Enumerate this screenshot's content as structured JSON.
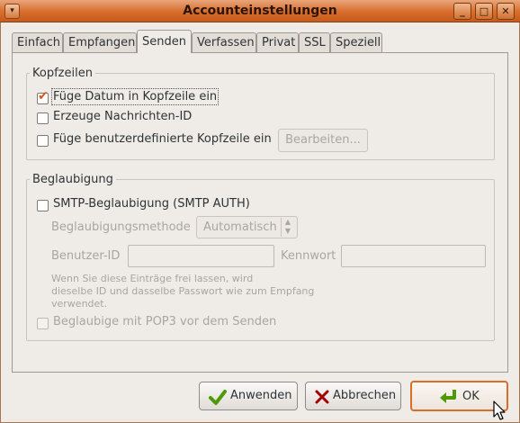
{
  "window": {
    "title": "Accounteinstellungen",
    "left_icon": "▾",
    "minimize_glyph": "_",
    "maximize_glyph": "□",
    "close_glyph": "✕"
  },
  "tabs": [
    {
      "label": "Einfach"
    },
    {
      "label": "Empfangen"
    },
    {
      "label": "Senden"
    },
    {
      "label": "Verfassen"
    },
    {
      "label": "Privat"
    },
    {
      "label": "SSL"
    },
    {
      "label": "Speziell"
    }
  ],
  "kopfzeilen": {
    "legend": "Kopfzeilen",
    "datum_label": "Füge Datum in Kopfzeile ein",
    "datum_checked": true,
    "nachrichten_id_label": "Erzeuge Nachrichten-ID",
    "nachrichten_id_checked": false,
    "benutzerdefiniert_label": "Füge benutzerdefinierte Kopfzeile ein",
    "benutzerdefiniert_checked": false,
    "bearbeiten_label": "Bearbeiten..."
  },
  "beglaubigung": {
    "legend": "Beglaubigung",
    "smtp_auth_label": "SMTP-Beglaubigung (SMTP AUTH)",
    "smtp_auth_checked": false,
    "methode_label": "Beglaubigungsmethode",
    "methode_value": "Automatisch",
    "benutzer_label": "Benutzer-ID",
    "benutzer_value": "",
    "kennwort_label": "Kennwort",
    "kennwort_value": "",
    "hint_line1": "Wenn Sie diese Einträge frei lassen, wird",
    "hint_line2": "dieselbe ID und dasselbe Passwort wie zum Empfang",
    "hint_line3": "verwendet.",
    "pop3_label": "Beglaubige mit POP3 vor dem Senden",
    "pop3_checked": false
  },
  "buttons": {
    "apply_label": "Anwenden",
    "cancel_label": "Abbrechen",
    "ok_label": "OK"
  },
  "colors": {
    "accent": "#d86d2c",
    "check_mark": "#d25a1b",
    "apply_icon": "#4e9a06",
    "cancel_icon": "#a40000"
  }
}
